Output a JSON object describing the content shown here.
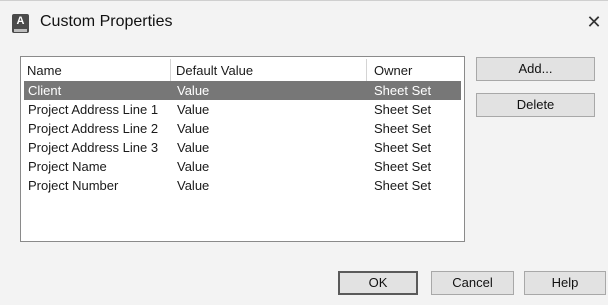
{
  "dialog": {
    "title": "Custom Properties",
    "close_label": "✕"
  },
  "list": {
    "columns": [
      "Name",
      "Default Value",
      "Owner"
    ],
    "rows": [
      [
        "Client",
        "Value",
        "Sheet Set"
      ],
      [
        "Project Address Line 1",
        "Value",
        "Sheet Set"
      ],
      [
        "Project Address Line 2",
        "Value",
        "Sheet Set"
      ],
      [
        "Project Address Line 3",
        "Value",
        "Sheet Set"
      ],
      [
        "Project Name",
        "Value",
        "Sheet Set"
      ],
      [
        "Project Number",
        "Value",
        "Sheet Set"
      ]
    ],
    "selected_row": "Client"
  },
  "side_buttons": {
    "add": "Add...",
    "delete": "Delete"
  },
  "footer_buttons": {
    "ok": "OK",
    "cancel": "Cancel",
    "help": "Help"
  }
}
